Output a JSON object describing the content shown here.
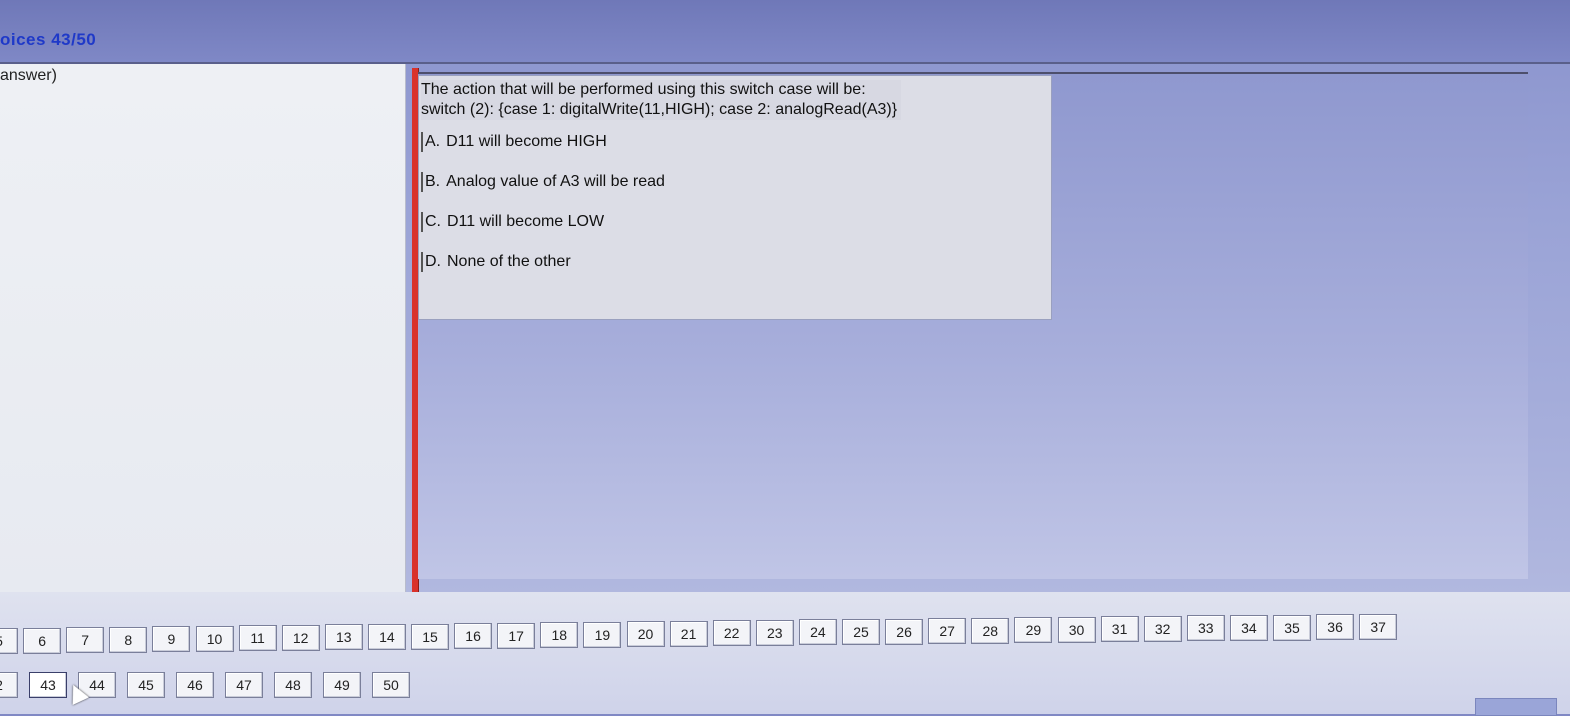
{
  "header": {
    "title": "oices 43/50"
  },
  "left_panel": {
    "label": "answer)"
  },
  "question": {
    "line1": "The action that will be performed using this switch case will be:",
    "line2": "switch (2): {case 1: digitalWrite(11,HIGH); case 2: analogRead(A3)}",
    "options": [
      {
        "letter": "A.",
        "text": "D11 will become HIGH"
      },
      {
        "letter": "B.",
        "text": "Analog value of A3 will be read"
      },
      {
        "letter": "C.",
        "text": "D11 will become LOW"
      },
      {
        "letter": "D.",
        "text": "None of the other"
      }
    ]
  },
  "navigation": {
    "row1": [
      "5",
      "6",
      "7",
      "8",
      "9",
      "10",
      "11",
      "12",
      "13",
      "14",
      "15",
      "16",
      "17",
      "18",
      "19",
      "20",
      "21",
      "22",
      "23",
      "24",
      "25",
      "26",
      "27",
      "28",
      "29",
      "30",
      "31",
      "32",
      "33",
      "34",
      "35",
      "36",
      "37"
    ],
    "row2": [
      "2",
      "43",
      "44",
      "45",
      "46",
      "47",
      "48",
      "49",
      "50"
    ],
    "current": "43"
  }
}
